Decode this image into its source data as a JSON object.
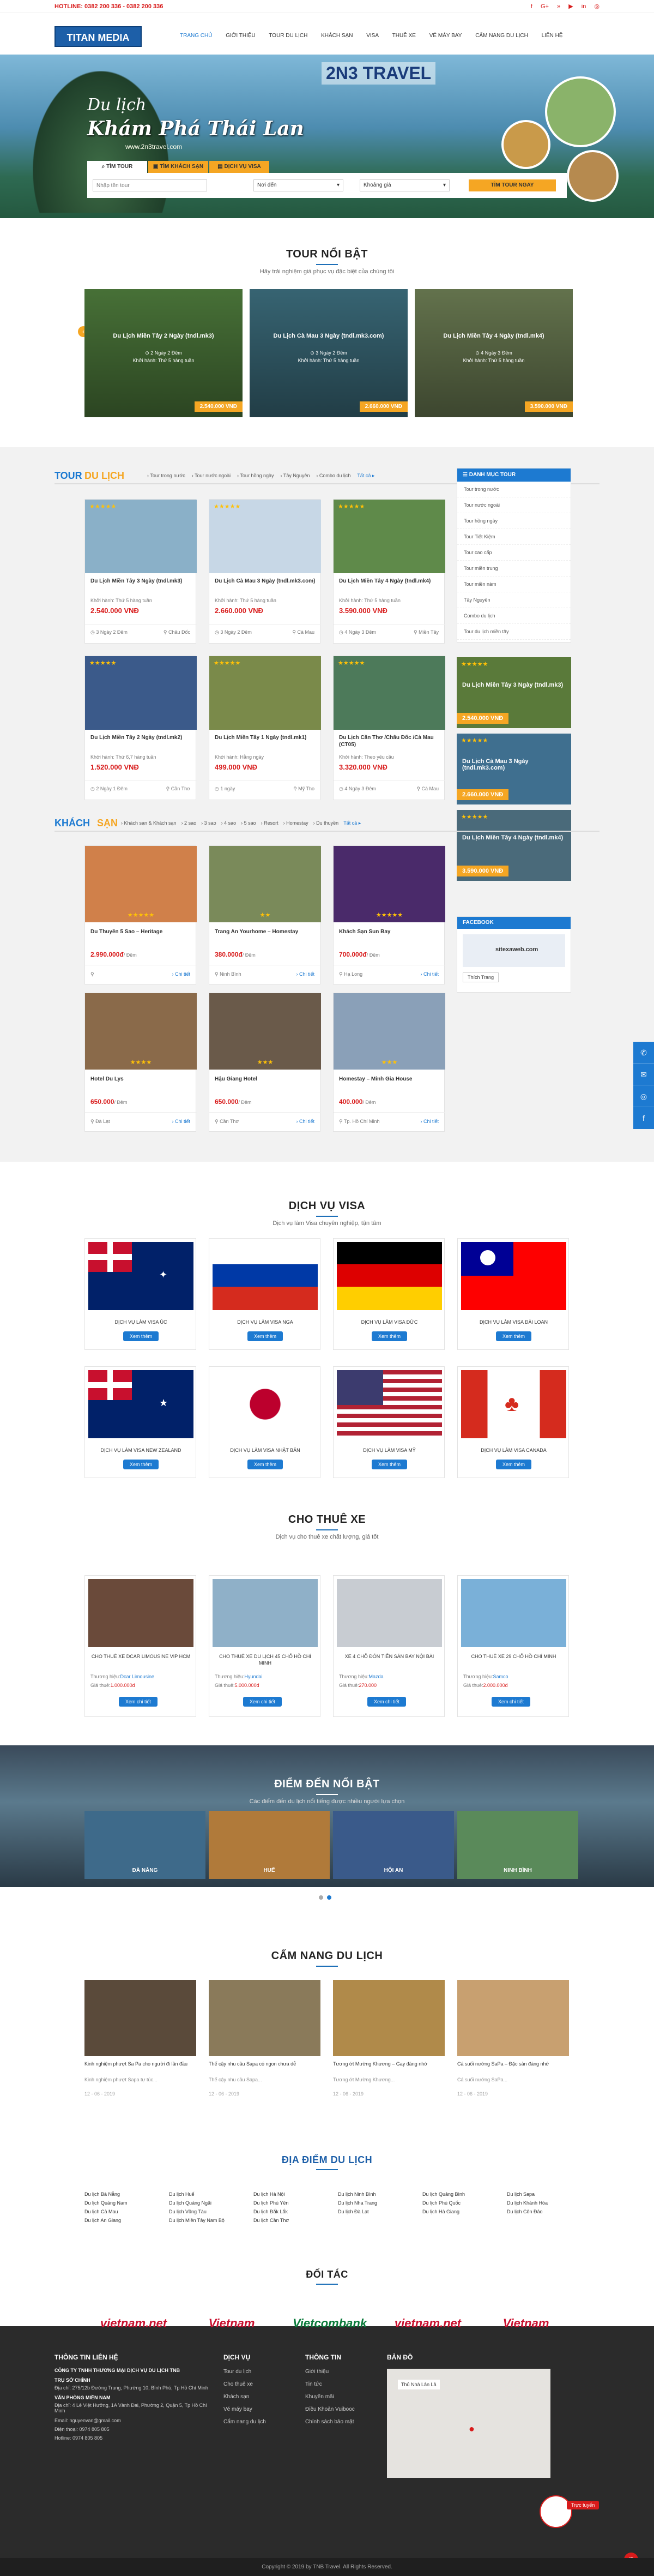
{
  "topbar": {
    "hotline": "HOTLINE: 0382 200 336 - 0382 200 336",
    "social": [
      "f",
      "G+",
      "»",
      "▶",
      "in",
      "◎"
    ]
  },
  "header": {
    "logo": "TITAN MEDIA",
    "nav": [
      "TRANG CHỦ",
      "GIỚI THIỆU",
      "TOUR DU LỊCH",
      "KHÁCH SẠN",
      "VISA",
      "THUÊ XE",
      "VÉ MÁY BAY",
      "CẨM NANG DU LỊCH",
      "LIÊN HỆ"
    ]
  },
  "hero": {
    "brand": "2N3 TRAVEL",
    "slogan": "Du lịch",
    "headline": "Khám Phá Thái Lan",
    "site": "www.2n3travel.com",
    "tabs": [
      "TÌM TOUR",
      "TÌM KHÁCH SẠN",
      "DỊCH VỤ VISA"
    ],
    "input_placeholder": "Nhập tên tour",
    "select1": "Nơi đến",
    "select2": "Khoảng giá",
    "search_btn": "TÌM TOUR NGAY"
  },
  "featured": {
    "title": "TOUR NỔI BẬT",
    "sub": "Hãy trải nghiệm giá phục vụ đặc biệt của chúng tôi",
    "items": [
      {
        "name": "Du Lịch Miền Tây 2 Ngày (tndl.mk3)",
        "l1": "⊙ 2 Ngày 2 Đêm",
        "l2": "Khởi hành: Thứ 5 hàng tuần",
        "price": "2.540.000 VNĐ"
      },
      {
        "name": "Du Lịch Cà Mau 3 Ngày (tndl.mk3.com)",
        "l1": "⊙ 3 Ngày 2 Đêm",
        "l2": "Khởi hành: Thứ 5 hàng tuần",
        "price": "2.660.000 VNĐ"
      },
      {
        "name": "Du Lịch Miền Tây 4 Ngày (tndl.mk4)",
        "l1": "⊙ 4 Ngày 3 Đêm",
        "l2": "Khởi hành: Thứ 5 hàng tuần",
        "price": "3.590.000 VNĐ"
      }
    ]
  },
  "tours": {
    "title1": "TOUR",
    "title2": "DU LỊCH",
    "tabs": [
      "› Tour trong nước",
      "› Tour nước ngoài",
      "› Tour hồng ngày",
      "› Tây Nguyên",
      "› Combo du lịch",
      "Tất cả ▸"
    ],
    "items": [
      {
        "name": "Du Lịch Miền Tây 3 Ngày (tndl.mk3)",
        "dep": "Khởi hành: Thứ 5 hàng tuần",
        "price": "2.540.000 VNĐ",
        "days": "3 Ngày 2 Đêm",
        "place": "Châu Đốc"
      },
      {
        "name": "Du Lịch Cà Mau 3 Ngày (tndl.mk3.com)",
        "dep": "Khởi hành: Thứ 5 hàng tuần",
        "price": "2.660.000 VNĐ",
        "days": "3 Ngày 2 Đêm",
        "place": "Cà Mau"
      },
      {
        "name": "Du Lịch Miền Tây 4 Ngày (tndl.mk4)",
        "dep": "Khởi hành: Thứ 5 hàng tuần",
        "price": "3.590.000 VNĐ",
        "days": "4 Ngày 3 Đêm",
        "place": "Miền Tây"
      },
      {
        "name": "Du Lịch Miền Tây 2 Ngày (tndl.mk2)",
        "dep": "Khởi hành: Thứ 6,7 hàng tuần",
        "price": "1.520.000 VNĐ",
        "days": "2 Ngày 1 Đêm",
        "place": "Cần Thơ"
      },
      {
        "name": "Du Lịch Miền Tây 1 Ngày (tndl.mk1)",
        "dep": "Khởi hành: Hằng ngày",
        "price": "499.000 VNĐ",
        "days": "1 ngày",
        "place": "Mỹ Tho"
      },
      {
        "name": "Du Lịch Cần Thơ /Châu Đốc /Cà Mau (CT05)",
        "dep": "Khởi hành: Theo yêu cầu",
        "price": "3.320.000 VNĐ",
        "days": "4 Ngày 3 Đêm",
        "place": "Cà Mau"
      }
    ]
  },
  "sidebar": {
    "title": "DANH MỤC TOUR",
    "items": [
      "Tour trong nước",
      "Tour nước ngoài",
      "Tour hồng ngày",
      "Tour Tiết Kiệm",
      "Tour cao cấp",
      "Tour miền trung",
      "Tour miền nàm",
      "Tây Nguyên",
      "Combo du lịch",
      "Tour du lịch miền tây"
    ],
    "promos": [
      {
        "name": "Du Lịch Miền Tây 3 Ngày (tndl.mk3)",
        "price": "2.540.000 VNĐ"
      },
      {
        "name": "Du Lịch Cà Mau 3 Ngày (tndl.mk3.com)",
        "price": "2.660.000 VNĐ"
      },
      {
        "name": "Du Lịch Miền Tây 4 Ngày (tndl.mk4)",
        "price": "3.590.000 VNĐ"
      }
    ],
    "fb_title": "FACEBOOK",
    "fb_page": "sitexaweb.com",
    "fb_btn": "Thích Trang"
  },
  "hotels": {
    "title1": "KHÁCH",
    "title2": "SẠN",
    "tabs": [
      "› Khách sạn & Khách sạn",
      "› 2 sao",
      "› 3 sao",
      "› 4 sao",
      "› 5 sao",
      "› Resort",
      "› Homestay",
      "› Du thuyền",
      "Tất cả ▸"
    ],
    "unit": "/ Đêm",
    "detail": "› Chi tiết",
    "items": [
      {
        "name": "Du Thuyền 5 Sao – Heritage",
        "price": "2.990.000đ",
        "place": "",
        "stars": "★★★★★"
      },
      {
        "name": "Trang An Yourhome – Homestay",
        "price": "380.000đ",
        "place": "Ninh Bình",
        "stars": "★★"
      },
      {
        "name": "Khách Sạn Sun Bay",
        "price": "700.000đ",
        "place": "Hạ Long",
        "stars": "★★★★★"
      },
      {
        "name": "Hotel Du Lys",
        "price": "650.000",
        "place": "Đà Lạt",
        "stars": "★★★★"
      },
      {
        "name": "Hậu Giang Hotel",
        "price": "650.000",
        "place": "Cần Thơ",
        "stars": "★★★"
      },
      {
        "name": "Homestay – Minh Gia House",
        "price": "400.000",
        "place": "Tp. Hồ Chí Minh",
        "stars": "★★★"
      }
    ]
  },
  "visa": {
    "title": "DỊCH VỤ VISA",
    "sub": "Dịch vụ làm Visa chuyên nghiệp, tận tâm",
    "btn": "Xem thêm",
    "items": [
      "DỊCH VỤ LÀM VISA ÚC",
      "DỊCH VỤ LÀM VISA NGA",
      "DỊCH VỤ LÀM VISA ĐỨC",
      "DỊCH VỤ LÀM VISA ĐÀI LOAN",
      "DỊCH VỤ LÀM VISA NEW ZEALAND",
      "DỊCH VỤ LÀM VISA NHẬT BẢN",
      "DỊCH VỤ LÀM VISA MỸ",
      "DỊCH VỤ LÀM VISA CANADA"
    ]
  },
  "cars": {
    "title": "CHO THUÊ XE",
    "sub": "Dịch vụ cho thuê xe chất lượng, giá tốt",
    "brand_lbl": "Thương hiệu:",
    "price_lbl": "Giá thuê:",
    "btn": "Xem chi tiết",
    "items": [
      {
        "name": "CHO THUÊ XE DCAR LIMOUSINE VIP HCM",
        "brand": "Dcar Limousine",
        "price": "1.000.000đ"
      },
      {
        "name": "CHO THUÊ XE DU LỊCH 45 CHỖ HỒ CHÍ MINH",
        "brand": "Hyundai",
        "price": "5.000.000đ"
      },
      {
        "name": "XE 4 CHỖ ĐÓN TIỄN SÂN BAY NỘI BÀI",
        "brand": "Mazda",
        "price": "270.000"
      },
      {
        "name": "CHO THUÊ XE 29 CHỖ HỒ CHÍ MINH",
        "brand": "Samco",
        "price": "2.000.000đ"
      }
    ]
  },
  "dest": {
    "title": "ĐIỂM ĐẾN NỔI BẬT",
    "sub": "Các điểm đến du lịch nổi tiếng được nhiều người lựa chọn",
    "items": [
      "ĐÀ NẴNG",
      "HUẾ",
      "HỘI AN",
      "NINH BÌNH"
    ]
  },
  "guide": {
    "title": "CẨM NANG DU LỊCH",
    "items": [
      {
        "title": "Kinh nghiệm phượt Sa Pa cho người đi lần đầu",
        "text": "Kinh nghiệm phượt Sapa tự túc...",
        "date": "12 - 06 - 2019"
      },
      {
        "title": "Thế cậy nhu cầu Sapa có ngon chưa dễ",
        "text": "Thế cậy nhu cầu Sapa...",
        "date": "12 - 06 - 2019"
      },
      {
        "title": "Tương ớt Mường Khương – Gay đáng nhớ",
        "text": "Tương ớt Mường Khương...",
        "date": "12 - 06 - 2019"
      },
      {
        "title": "Cá suối nướng SaPa – Đặc sản đáng nhớ",
        "text": "Cá suối nướng SaPa...",
        "date": "12 - 06 - 2019"
      }
    ]
  },
  "places": {
    "title": "ĐỊA ĐIỂM DU LỊCH",
    "cols": [
      [
        "Du lịch Bà Nẵng",
        "Du lịch Quảng Nam",
        "Du lịch Cà Mau",
        "Du lịch An Giang"
      ],
      [
        "Du lịch Huế",
        "Du lịch Quảng Ngãi",
        "Du lịch Vũng Tàu",
        "Du lịch Miền Tây Nam Bộ"
      ],
      [
        "Du lịch Hà Nội",
        "Du lịch Phú Yên",
        "Du lịch Đắk Lắk",
        "Du lịch Cần Thơ"
      ],
      [
        "Du lịch Ninh Bình",
        "Du lịch Nha Trang",
        "Du lịch Đà Lạt"
      ],
      [
        "Du lịch Quảng Bình",
        "Du lịch Phú Quốc",
        "Du lịch Hà Giang"
      ],
      [
        "Du lịch Sapa",
        "Du lịch Khánh Hòa",
        "Du lịch Côn Đảo"
      ]
    ]
  },
  "partners": {
    "title": "ĐỐI TÁC",
    "items": [
      "vietnam.net",
      "Vietnam",
      "Vietcombank",
      "vietnam.net",
      "Vietnam"
    ]
  },
  "footer": {
    "c1_title": "THÔNG TIN LIÊN HỆ",
    "company": "CÔNG TY TNHH THƯƠNG MẠI DỊCH VỤ DU LỊCH TNB",
    "hq_lbl": "TRỤ SỞ CHÍNH",
    "hq": "Địa chỉ: 275/12b Đường Trung, Phường 10, Bình Phú, Tp Hồ Chí Minh",
    "branch_lbl": "VĂN PHÒNG MIỀN NAM",
    "branch": "Địa chỉ: 4 Lê Việt Hưởng, 1A Vành Đai, Phường 2, Quận 5, Tp Hồ Chí Minh",
    "email": "Email: nguyenvan@gmail.com",
    "phone": "Điện thoại: 0974 805 805",
    "hotline": "Hotline: 0974 805 805",
    "c2_title": "DỊCH VỤ",
    "c2": [
      "Tour du lịch",
      "Cho thuê xe",
      "Khách sạn",
      "Vé máy bay",
      "Cẩm nang du lịch"
    ],
    "c3_title": "THÔNG TIN",
    "c3": [
      "Giới thiệu",
      "Tin tức",
      "Khuyến mãi",
      "Điều Khoản Vuibooc",
      "Chính sách bảo mật"
    ],
    "c4_title": "BẢN ĐỒ",
    "map_label": "Thủ Nhà Lân Lả",
    "copyright": "Copyright © 2019 by TNB Travel. All Rights Reserved.",
    "chat": "Trực tuyến"
  },
  "colors": {
    "primary": "#1d7ad1",
    "accent": "#f5a623",
    "price": "#d81b1b",
    "dark": "#2b2b2b"
  }
}
